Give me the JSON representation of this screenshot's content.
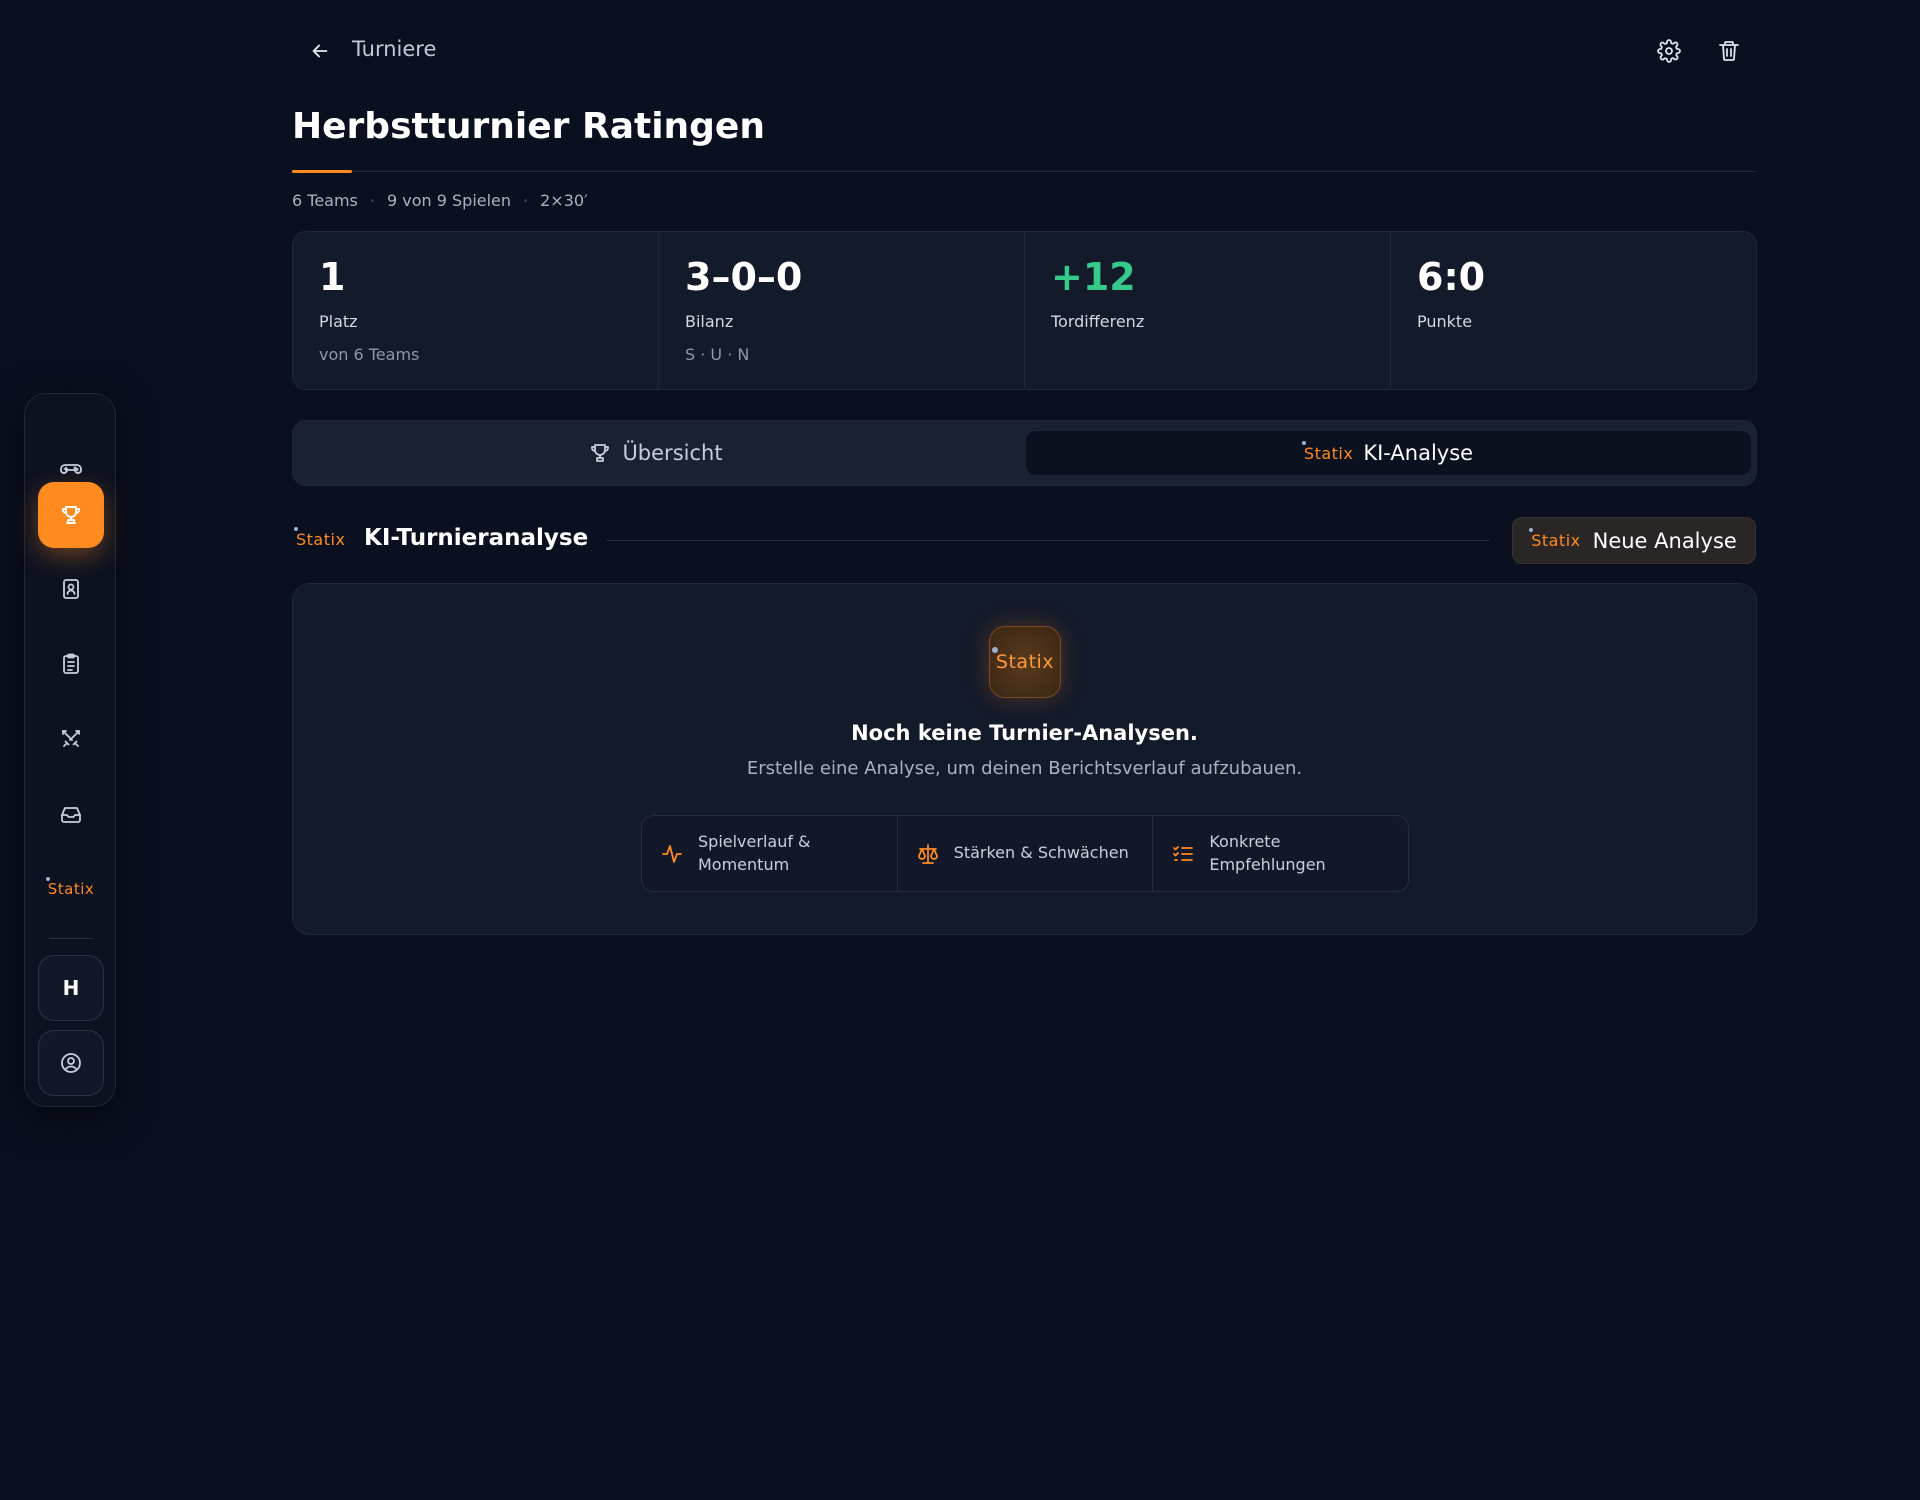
{
  "header": {
    "breadcrumb": "Turniere",
    "title": "Herbstturnier Ratingen"
  },
  "meta": [
    "6 Teams",
    "9 von 9 Spielen",
    "2×30′"
  ],
  "stats": [
    {
      "value": "1",
      "label": "Platz",
      "sub": "von 6 Teams"
    },
    {
      "value": "3–0–0",
      "label": "Bilanz",
      "sub": "S · U · N"
    },
    {
      "value": "+12",
      "label": "Tordifferenz",
      "sub": ""
    },
    {
      "value": "6:0",
      "label": "Punkte",
      "sub": ""
    }
  ],
  "tabs": [
    {
      "label": "Übersicht",
      "icon": "trophy-icon"
    },
    {
      "label": "KI-Analyse",
      "icon": "statix-logo",
      "active": true
    }
  ],
  "brand": "Statix",
  "section": {
    "title": "KI-Turnieranalyse",
    "new_button": "Neue Analyse"
  },
  "empty_state": {
    "title": "Noch keine Turnier-Analysen.",
    "subtitle": "Erstelle eine Analyse, um deinen Berichtsverlauf aufzubauen.",
    "features": [
      {
        "line1": "Spielverlauf &",
        "line2": "Momentum",
        "icon": "activity-icon"
      },
      {
        "line1": "Stärken & Schwächen",
        "line2": "",
        "icon": "scale-icon"
      },
      {
        "line1": "Konkrete",
        "line2": "Empfehlungen",
        "icon": "checklist-icon"
      }
    ]
  },
  "sidebar": {
    "items": [
      {
        "icon": "gamepad-icon"
      },
      {
        "icon": "trophy-icon",
        "active": true
      },
      {
        "icon": "contact-book-icon"
      },
      {
        "icon": "clipboard-icon"
      },
      {
        "icon": "crossed-swords-icon"
      },
      {
        "icon": "inbox-icon"
      },
      {
        "icon": "statix-logo"
      }
    ],
    "team_initial": "H",
    "profile_icon": "user-circle-icon"
  },
  "colors": {
    "accent": "#ff8a1f",
    "positive": "#35c98a",
    "background": "#0b1020",
    "card": "#131a2a"
  }
}
